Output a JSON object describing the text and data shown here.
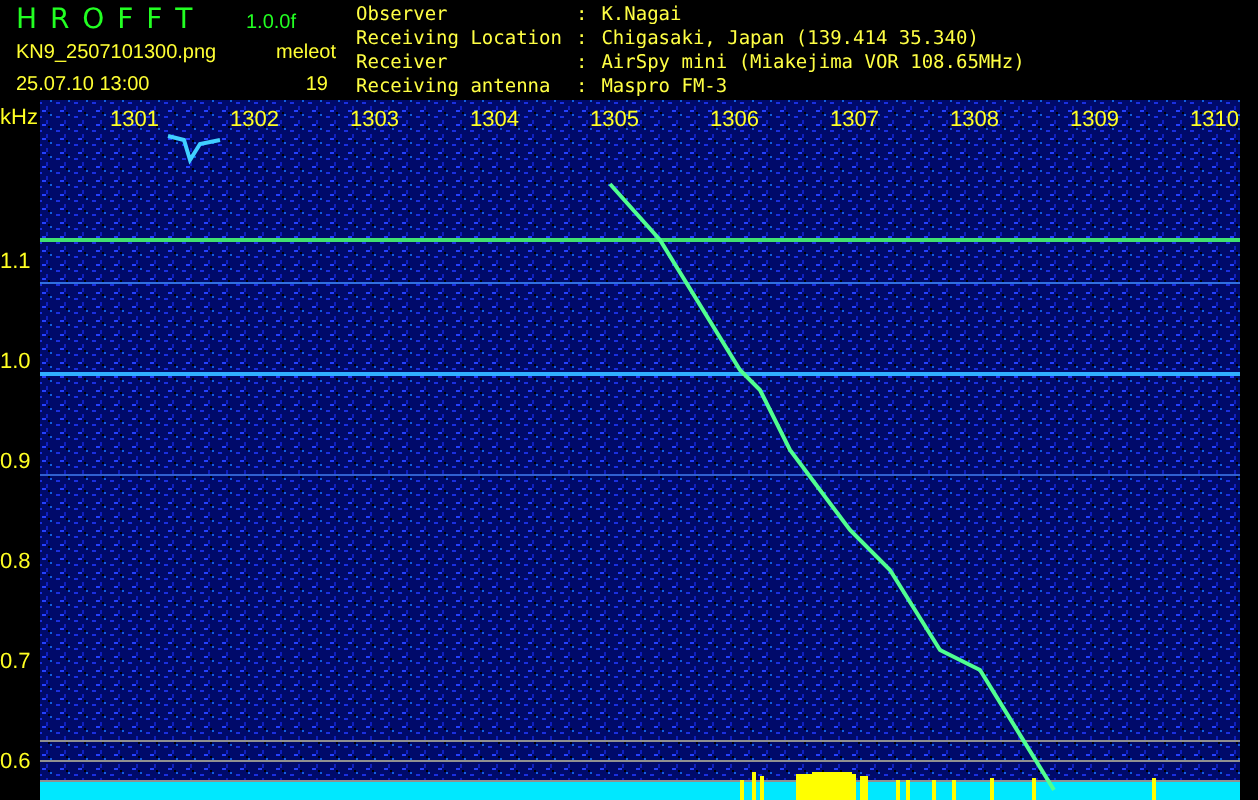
{
  "header": {
    "app_name": "H R O F F T",
    "version": "1.0.0f",
    "filename": "KN9_2507101300.png",
    "datetime": "25.07.10 13:00",
    "count_label": "meleot",
    "count": "19"
  },
  "info": [
    {
      "label": "Observer",
      "separator": ":",
      "value": "K.Nagai"
    },
    {
      "label": "Receiving Location",
      "separator": ":",
      "value": "Chigasaki, Japan (139.414 35.340)"
    },
    {
      "label": "Receiver",
      "separator": ":",
      "value": "AirSpy mini (Miakejima VOR 108.65MHz)"
    },
    {
      "label": "Receiving antenna",
      "separator": ":",
      "value": "Maspro FM-3"
    }
  ],
  "spectrogram": {
    "unit": "kHz",
    "time_labels": [
      "1301",
      "1302",
      "1303",
      "1304",
      "1305",
      "1306",
      "1307",
      "1308",
      "1309",
      "1310"
    ],
    "freq_labels": [
      "1.1",
      "1.0",
      "0.9",
      "0.8",
      "0.7",
      "0.6"
    ]
  }
}
